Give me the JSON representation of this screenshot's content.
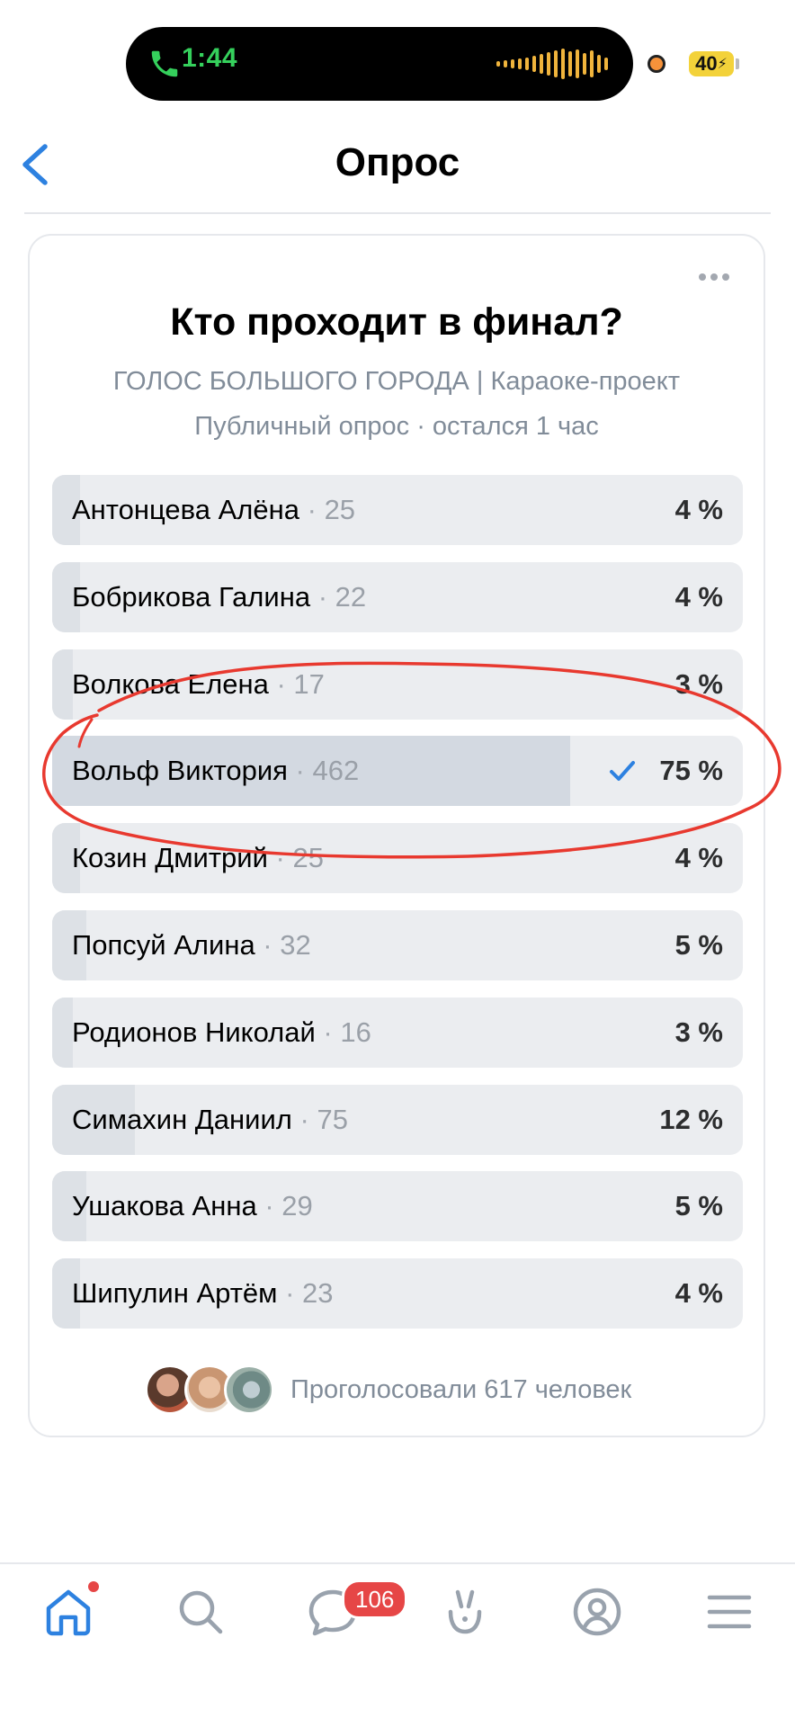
{
  "status_bar": {
    "call_time": "1:44",
    "battery": "40",
    "accent_call": "#35d05c",
    "accent_battery": "#f3d23a"
  },
  "header": {
    "title": "Опрос"
  },
  "poll": {
    "title": "Кто проходит в финал?",
    "subtitle": "ГОЛОС БОЛЬШОГО ГОРОДА | Караоке-проект",
    "meta": "Публичный опрос · остался 1 час",
    "options": [
      {
        "name": "Антонцева Алёна",
        "count": "25",
        "percent": "4 %",
        "share": 4,
        "voted": false
      },
      {
        "name": "Бобрикова Галина",
        "count": "22",
        "percent": "4 %",
        "share": 4,
        "voted": false
      },
      {
        "name": "Волкова Елена",
        "count": "17",
        "percent": "3 %",
        "share": 3,
        "voted": false
      },
      {
        "name": "Вольф Виктория",
        "count": "462",
        "percent": "75 %",
        "share": 75,
        "voted": true
      },
      {
        "name": "Козин Дмитрий",
        "count": "25",
        "percent": "4 %",
        "share": 4,
        "voted": false
      },
      {
        "name": "Попсуй Алина",
        "count": "32",
        "percent": "5 %",
        "share": 5,
        "voted": false
      },
      {
        "name": "Родионов Николай",
        "count": "16",
        "percent": "3 %",
        "share": 3,
        "voted": false
      },
      {
        "name": "Симахин Даниил",
        "count": "75",
        "percent": "12 %",
        "share": 12,
        "voted": false
      },
      {
        "name": "Ушакова Анна",
        "count": "29",
        "percent": "5 %",
        "share": 5,
        "voted": false
      },
      {
        "name": "Шипулин Артём",
        "count": "23",
        "percent": "4 %",
        "share": 4,
        "voted": false
      }
    ],
    "voters_text": "Проголосовали 617 человек"
  },
  "tabbar": {
    "items": [
      "home-icon",
      "search-icon",
      "messages-icon",
      "clips-icon",
      "profile-icon",
      "menu-icon"
    ],
    "messages_badge": "106",
    "accent": "#2d81e0",
    "badge_color": "#e64646"
  },
  "annotation_color": "#e8392f"
}
